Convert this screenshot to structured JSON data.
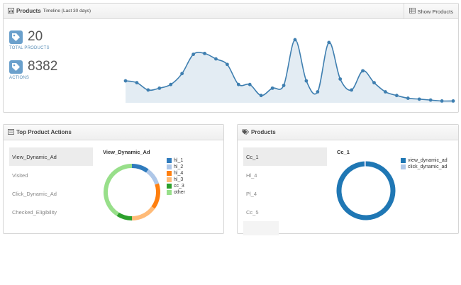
{
  "colors": {
    "accent": "#3f7fb0",
    "line": "#3f7fb0",
    "area": "#e3ecf3",
    "tag": "#6aa0cc"
  },
  "timeline_panel": {
    "title": "Products",
    "subtitle": "Timeline (Last 30 days)",
    "title_icon": "bar-chart-icon",
    "show_products_label": "Show Products",
    "show_products_icon": "table-icon",
    "stats": [
      {
        "value": "20",
        "label": "TOTAL PRODUCTS",
        "icon": "tag-icon"
      },
      {
        "value": "8382",
        "label": "ACTIONS",
        "icon": "tag-icon"
      }
    ]
  },
  "chart_data": [
    {
      "type": "area",
      "title": "",
      "xlabel": "",
      "ylabel": "",
      "x": [
        1,
        2,
        3,
        4,
        5,
        6,
        7,
        8,
        9,
        10,
        11,
        12,
        13,
        14,
        15,
        16,
        17,
        18,
        19,
        20,
        21,
        22,
        23,
        24,
        25,
        26,
        27,
        28,
        29,
        30
      ],
      "values": [
        120,
        110,
        70,
        80,
        100,
        160,
        265,
        270,
        240,
        210,
        100,
        100,
        40,
        80,
        95,
        345,
        120,
        60,
        330,
        130,
        70,
        175,
        110,
        60,
        40,
        25,
        20,
        15,
        10,
        10
      ],
      "ylim": [
        0,
        380
      ],
      "grid": false
    },
    {
      "type": "pie",
      "title": "View_Dynamic_Ad",
      "labels": [
        "hl_1",
        "hl_2",
        "hl_4",
        "hl_3",
        "cc_3",
        "other"
      ],
      "values": [
        10,
        10,
        15,
        15,
        9,
        41
      ],
      "colors": [
        "#2f7bbd",
        "#aec7e8",
        "#ff7f0e",
        "#ffbb78",
        "#2ca02c",
        "#98df8a"
      ]
    },
    {
      "type": "pie",
      "title": "Cc_1",
      "labels": [
        "view_dynamic_ad",
        "click_dynamic_ad"
      ],
      "values": [
        99,
        1
      ],
      "colors": [
        "#1f77b4",
        "#aec7e8"
      ]
    }
  ],
  "actions_panel": {
    "title": "Top Product Actions",
    "title_icon": "list-icon",
    "items": [
      "View_Dynamic_Ad",
      "Visited",
      "Click_Dynamic_Ad",
      "Checked_Eligibility"
    ]
  },
  "products_panel": {
    "title": "Products",
    "title_icon": "tags-icon",
    "items": [
      "Cc_1",
      "Hl_4",
      "Pl_4",
      "Cc_5"
    ]
  }
}
